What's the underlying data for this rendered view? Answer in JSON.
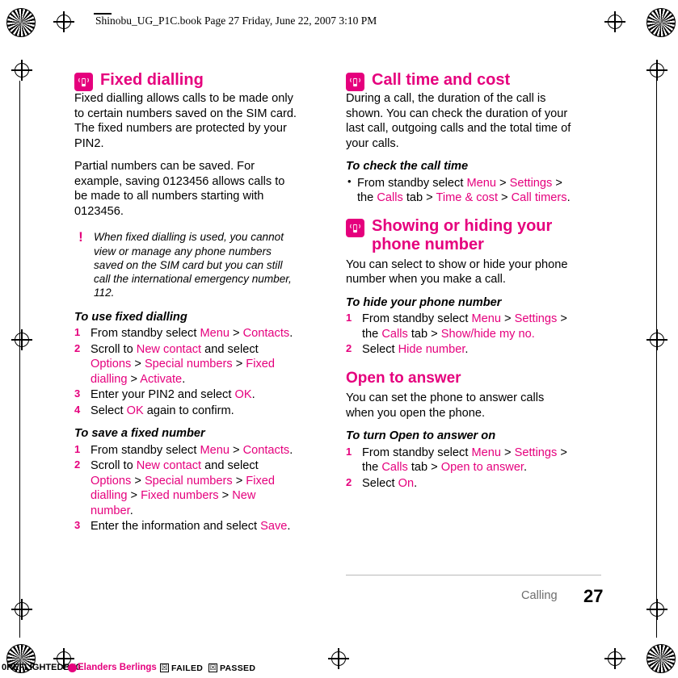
{
  "header": {
    "text": "Shinobu_UG_P1C.book  Page 27  Friday, June 22, 2007  3:10 PM"
  },
  "colors": {
    "accent": "#e5007d",
    "footer_gray": "#6d6d6d"
  },
  "left_column": {
    "section1": {
      "title": "Fixed dialling",
      "icon": "phone-signal-icon",
      "paragraphs": [
        "Fixed dialling allows calls to be made only to certain numbers saved on the SIM card. The fixed numbers are protected by your PIN2.",
        "Partial numbers can be saved. For example, saving 0123456 allows calls to be made to all numbers starting with 0123456."
      ],
      "note": "When fixed dialling is used, you cannot view or manage any phone numbers saved on the SIM card but you can still call the international emergency number, 112.",
      "sub1": {
        "heading": "To use fixed dialling",
        "steps": [
          [
            {
              "t": "From standby select ",
              "c": "black"
            },
            {
              "t": "Menu",
              "c": "pink"
            },
            {
              "t": " > ",
              "c": "black"
            },
            {
              "t": "Contacts",
              "c": "pink"
            },
            {
              "t": ".",
              "c": "black"
            }
          ],
          [
            {
              "t": "Scroll to ",
              "c": "black"
            },
            {
              "t": "New contact",
              "c": "pink"
            },
            {
              "t": " and select ",
              "c": "black"
            },
            {
              "t": "Options",
              "c": "pink"
            },
            {
              "t": " > ",
              "c": "black"
            },
            {
              "t": "Special numbers",
              "c": "pink"
            },
            {
              "t": " > ",
              "c": "black"
            },
            {
              "t": "Fixed dialling",
              "c": "pink"
            },
            {
              "t": " > ",
              "c": "black"
            },
            {
              "t": "Activate",
              "c": "pink"
            },
            {
              "t": ".",
              "c": "black"
            }
          ],
          [
            {
              "t": "Enter your PIN2 and select ",
              "c": "black"
            },
            {
              "t": "OK",
              "c": "pink"
            },
            {
              "t": ".",
              "c": "black"
            }
          ],
          [
            {
              "t": "Select ",
              "c": "black"
            },
            {
              "t": "OK",
              "c": "pink"
            },
            {
              "t": " again to confirm.",
              "c": "black"
            }
          ]
        ]
      },
      "sub2": {
        "heading": "To save a fixed number",
        "steps": [
          [
            {
              "t": "From standby select ",
              "c": "black"
            },
            {
              "t": "Menu",
              "c": "pink"
            },
            {
              "t": " > ",
              "c": "black"
            },
            {
              "t": "Contacts",
              "c": "pink"
            },
            {
              "t": ".",
              "c": "black"
            }
          ],
          [
            {
              "t": "Scroll to ",
              "c": "black"
            },
            {
              "t": "New contact",
              "c": "pink"
            },
            {
              "t": " and select ",
              "c": "black"
            },
            {
              "t": "Options",
              "c": "pink"
            },
            {
              "t": " > ",
              "c": "black"
            },
            {
              "t": "Special numbers",
              "c": "pink"
            },
            {
              "t": " > ",
              "c": "black"
            },
            {
              "t": "Fixed dialling",
              "c": "pink"
            },
            {
              "t": " > ",
              "c": "black"
            },
            {
              "t": "Fixed numbers",
              "c": "pink"
            },
            {
              "t": " > ",
              "c": "black"
            },
            {
              "t": "New number",
              "c": "pink"
            },
            {
              "t": ".",
              "c": "black"
            }
          ],
          [
            {
              "t": "Enter the information and select ",
              "c": "black"
            },
            {
              "t": "Save",
              "c": "pink"
            },
            {
              "t": ".",
              "c": "black"
            }
          ]
        ]
      }
    }
  },
  "right_column": {
    "section1": {
      "title": "Call time and cost",
      "icon": "phone-signal-icon",
      "paragraphs": [
        "During a call, the duration of the call is shown. You can check the duration of your last call, outgoing calls and the total time of your calls."
      ],
      "sub1": {
        "heading": "To check the call time",
        "bullets": [
          [
            {
              "t": "From standby select ",
              "c": "black"
            },
            {
              "t": "Menu",
              "c": "pink"
            },
            {
              "t": " > ",
              "c": "black"
            },
            {
              "t": "Settings",
              "c": "pink"
            },
            {
              "t": " > the ",
              "c": "black"
            },
            {
              "t": "Calls",
              "c": "pink"
            },
            {
              "t": " tab > ",
              "c": "black"
            },
            {
              "t": "Time & cost",
              "c": "pink"
            },
            {
              "t": " > ",
              "c": "black"
            },
            {
              "t": "Call timers",
              "c": "pink"
            },
            {
              "t": ".",
              "c": "black"
            }
          ]
        ]
      }
    },
    "section2": {
      "title": "Showing or hiding your phone number",
      "icon": "phone-signal-icon",
      "paragraphs": [
        "You can select to show or hide your phone number when you make a call."
      ],
      "sub1": {
        "heading": "To hide your phone number",
        "steps": [
          [
            {
              "t": "From standby select ",
              "c": "black"
            },
            {
              "t": "Menu",
              "c": "pink"
            },
            {
              "t": " > ",
              "c": "black"
            },
            {
              "t": "Settings",
              "c": "pink"
            },
            {
              "t": " > the ",
              "c": "black"
            },
            {
              "t": "Calls",
              "c": "pink"
            },
            {
              "t": " tab > ",
              "c": "black"
            },
            {
              "t": "Show/hide my no.",
              "c": "pink"
            }
          ],
          [
            {
              "t": "Select ",
              "c": "black"
            },
            {
              "t": "Hide number",
              "c": "pink"
            },
            {
              "t": ".",
              "c": "black"
            }
          ]
        ]
      }
    },
    "section3": {
      "title": "Open to answer",
      "paragraphs": [
        "You can set the phone to answer calls when you open the phone."
      ],
      "sub1": {
        "heading": "To turn Open to answer on",
        "steps": [
          [
            {
              "t": "From standby select ",
              "c": "black"
            },
            {
              "t": "Menu",
              "c": "pink"
            },
            {
              "t": " > ",
              "c": "black"
            },
            {
              "t": "Settings",
              "c": "pink"
            },
            {
              "t": " > the ",
              "c": "black"
            },
            {
              "t": "Calls",
              "c": "pink"
            },
            {
              "t": " tab > ",
              "c": "black"
            },
            {
              "t": "Open to answer",
              "c": "pink"
            },
            {
              "t": ".",
              "c": "black"
            }
          ],
          [
            {
              "t": "Select ",
              "c": "black"
            },
            {
              "t": "On",
              "c": "pink"
            },
            {
              "t": ".",
              "c": "black"
            }
          ]
        ]
      }
    }
  },
  "footer": {
    "chapter": "Calling",
    "page_number": "27"
  },
  "print_bar": {
    "preflighted": "0REFLIGHTEDBY0",
    "company": "Elanders Berlings",
    "failed_label": "FAILED",
    "passed_label": "PASSED",
    "failed_mark": "☒",
    "passed_mark": "☒"
  }
}
